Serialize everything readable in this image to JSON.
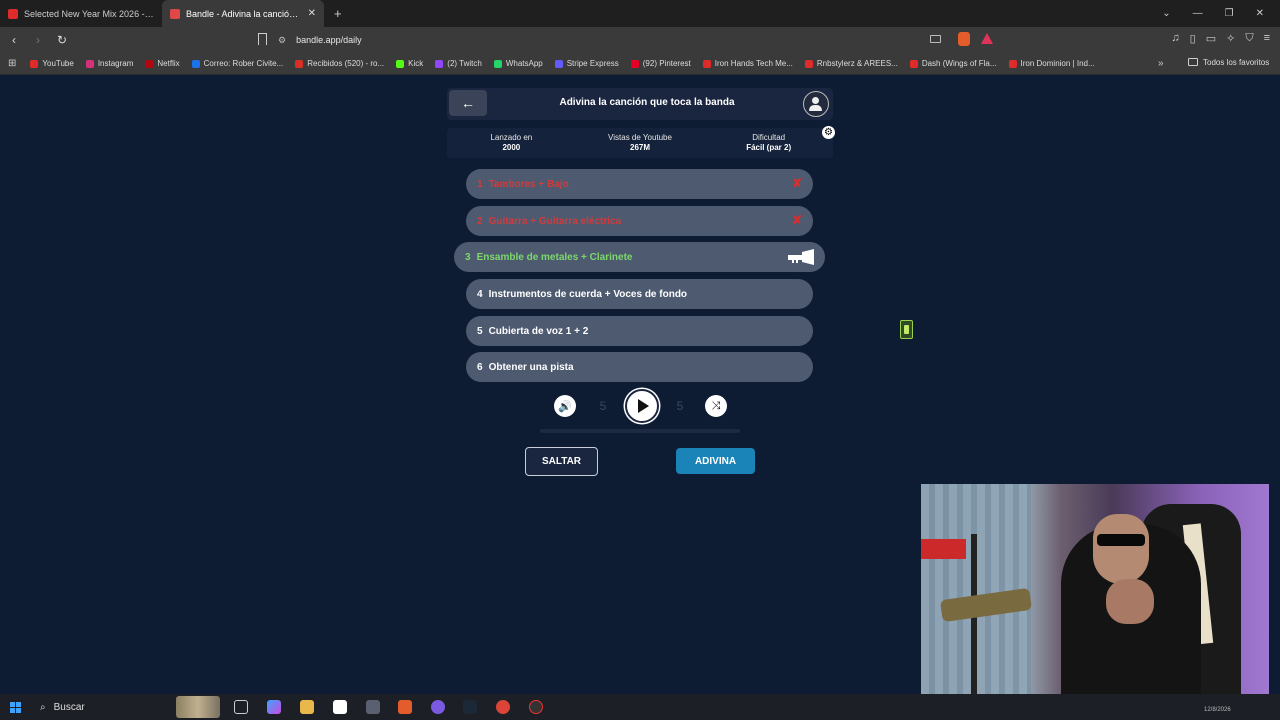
{
  "browser": {
    "tabs": [
      {
        "title": "Selected New Year Mix 2026 - YouTube",
        "color": "#e02b2b"
      },
      {
        "title": "Bandle - Adivina la canción, un ...",
        "color": "#e04848"
      }
    ],
    "new_tab": "+",
    "url": "bandle.app/daily",
    "bookmarks": [
      {
        "label": "YouTube",
        "color": "#e02b2b"
      },
      {
        "label": "Instagram",
        "color": "#d6307b"
      },
      {
        "label": "Netflix",
        "color": "#b20710"
      },
      {
        "label": "Correo: Rober Civite...",
        "color": "#1a73e8"
      },
      {
        "label": "Recibidos (520) - ro...",
        "color": "#d93025"
      },
      {
        "label": "Kick",
        "color": "#53fc18"
      },
      {
        "label": "(2) Twitch",
        "color": "#9146ff"
      },
      {
        "label": "WhatsApp",
        "color": "#25d366"
      },
      {
        "label": "Stripe Express",
        "color": "#635bff"
      },
      {
        "label": "(92) Pinterest",
        "color": "#e60023"
      },
      {
        "label": "Iron Hands Tech Me...",
        "color": "#e02b2b"
      },
      {
        "label": "Rnbstylerz & AREES...",
        "color": "#e02b2b"
      },
      {
        "label": "Dash (Wings of Fla...",
        "color": "#e02b2b"
      },
      {
        "label": "Iron Dominion | Ind...",
        "color": "#e02b2b"
      }
    ],
    "all_bookmarks": "Todos los favoritos"
  },
  "game": {
    "title": "Adivina la canción que toca la banda",
    "info": [
      {
        "label": "Lanzado en",
        "value": "2000"
      },
      {
        "label": "Vistas de Youtube",
        "value": "267M"
      },
      {
        "label": "Dificultad",
        "value": "Fácil (par 2)"
      }
    ],
    "clues": [
      {
        "num": "1",
        "text": "Tambores + Bajo",
        "state": "wrong"
      },
      {
        "num": "2",
        "text": "Guitarra + Guitarra eléctrica",
        "state": "wrong"
      },
      {
        "num": "3",
        "text": "Ensamble de metales + Clarinete",
        "state": "current"
      },
      {
        "num": "4",
        "text": "Instrumentos de cuerda + Voces de fondo",
        "state": "locked"
      },
      {
        "num": "5",
        "text": "Cubierta de voz 1 + 2",
        "state": "locked"
      },
      {
        "num": "6",
        "text": "Obtener una pista",
        "state": "locked"
      }
    ],
    "player": {
      "rewind": "5",
      "forward": "5"
    },
    "skip_label": "SALTAR",
    "guess_label": "ADIVINA"
  },
  "taskbar": {
    "search_placeholder": "Buscar",
    "date": "12/8/2026"
  },
  "colors": {
    "background": "#0d1b33",
    "wrong": "#d53a3a",
    "current": "#7bd86b",
    "guess_button": "#1a84b8"
  }
}
